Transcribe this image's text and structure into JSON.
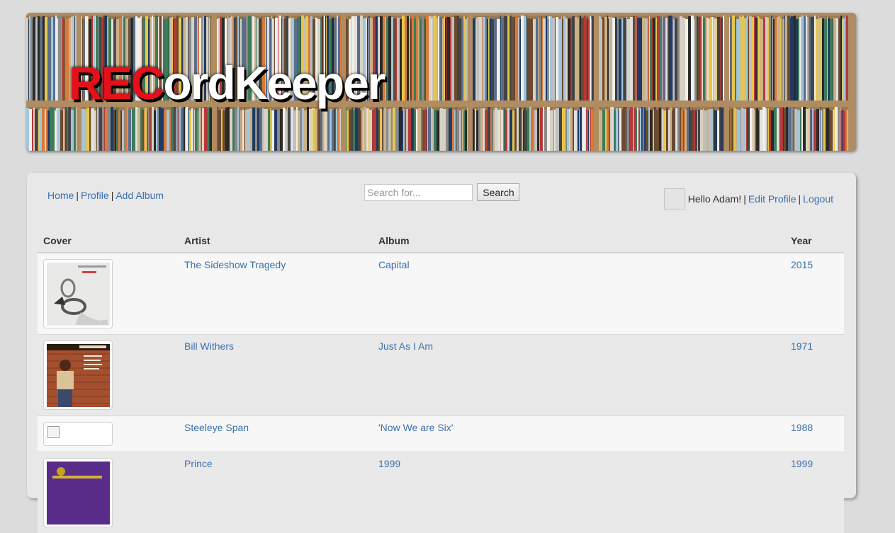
{
  "banner": {
    "logo_red": "REC",
    "logo_white": "ordKeeper"
  },
  "nav": {
    "home": "Home",
    "profile": "Profile",
    "add_album": "Add Album",
    "separator": "|"
  },
  "search": {
    "placeholder": "Search for...",
    "button_label": "Search"
  },
  "user": {
    "greeting": "Hello Adam!",
    "edit_profile": "Edit Profile",
    "logout": "Logout",
    "separator": "|"
  },
  "table": {
    "headers": {
      "cover": "Cover",
      "artist": "Artist",
      "album": "Album",
      "year": "Year"
    },
    "rows": [
      {
        "artist": "The Sideshow Tragedy",
        "album": "Capital",
        "year": "2015",
        "cover": "handcuffs-ring-cover"
      },
      {
        "artist": "Bill Withers",
        "album": "Just As I Am",
        "year": "1971",
        "cover": "man-brick-wall-cover"
      },
      {
        "artist": "Steeleye Span",
        "album": "'Now We are Six'",
        "year": "1988",
        "cover": "broken-image-icon"
      },
      {
        "artist": "Prince",
        "album": "1999",
        "year": "1999",
        "cover": "purple-cover"
      }
    ]
  },
  "colors": {
    "link": "#3a6fae",
    "logo_red": "#e5101a",
    "panel_bg": "#e8e8e8",
    "page_bg": "#dcdcdc"
  }
}
